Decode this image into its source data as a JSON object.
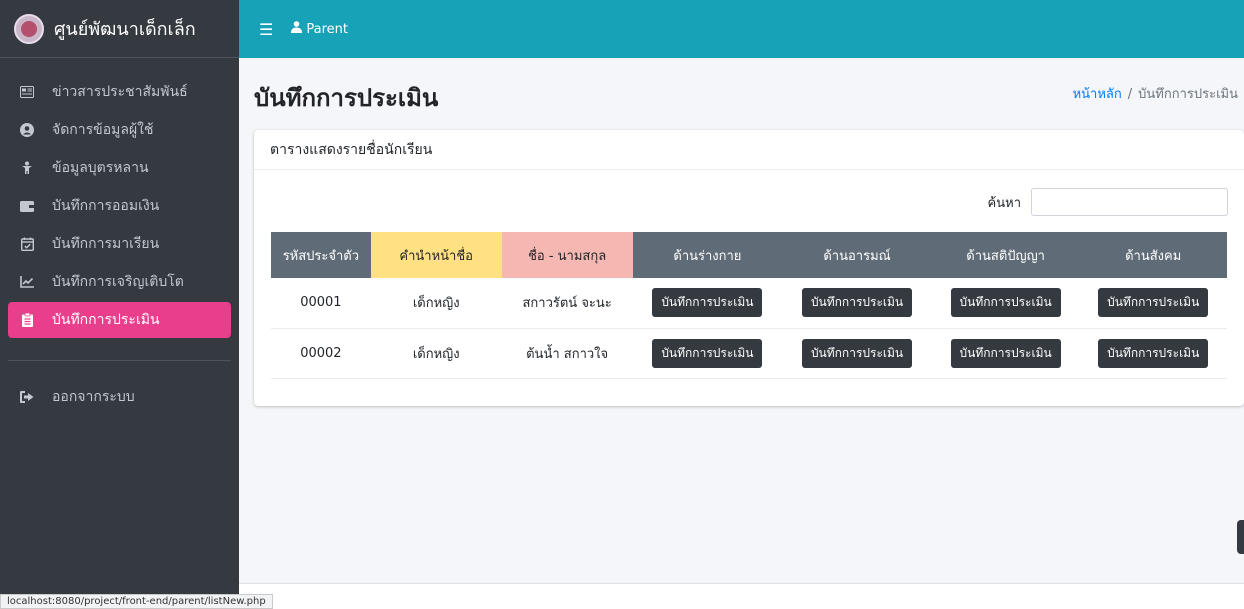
{
  "brand": {
    "title": "ศูนย์พัฒนาเด็กเล็ก"
  },
  "sidebar": {
    "items": [
      {
        "label": "ข่าวสารประชาสัมพันธ์",
        "icon": "newspaper-icon"
      },
      {
        "label": "จัดการข้อมูลผู้ใช้",
        "icon": "user-circle-icon"
      },
      {
        "label": "ข้อมูลบุตรหลาน",
        "icon": "child-icon"
      },
      {
        "label": "บันทึกการออมเงิน",
        "icon": "wallet-icon"
      },
      {
        "label": "บันทึกการมาเรียน",
        "icon": "calendar-check-icon"
      },
      {
        "label": "บันทึกการเจริญเติบโต",
        "icon": "chart-line-icon"
      },
      {
        "label": "บันทึกการประเมิน",
        "icon": "clipboard-icon",
        "active": true
      }
    ],
    "logout": {
      "label": "ออกจากระบบ",
      "icon": "sign-out-icon"
    }
  },
  "topbar": {
    "user_label": "Parent"
  },
  "page": {
    "title": "บันทึกการประเมิน"
  },
  "breadcrumb": {
    "home": "หน้าหลัก",
    "separator": "/",
    "current": "บันทึกการประเมิน"
  },
  "card": {
    "title": "ตารางแสดงรายชื่อนักเรียน",
    "search_label": "ค้นหา",
    "search_value": ""
  },
  "table": {
    "headers": [
      "รหัสประจำตัว",
      "คำนำหน้าชื่อ",
      "ชื่อ - นามสกุล",
      "ด้านร่างกาย",
      "ด้านอารมณ์",
      "ด้านสติปัญญา",
      "ด้านสังคม"
    ],
    "rows": [
      {
        "id": "00001",
        "prefix": "เด็กหญิง",
        "name": "สกาวรัตน์ จะนะ"
      },
      {
        "id": "00002",
        "prefix": "เด็กหญิง",
        "name": "ต้นน้ำ สกาวใจ"
      }
    ],
    "button_label": "บันทึกการประเมิน"
  },
  "status_bar": {
    "url": "localhost:8080/project/front-end/parent/listNew.php"
  },
  "colors": {
    "sidebar": "#343a40",
    "topbar": "#17a2b8",
    "active": "#e83e8c",
    "header_dark": "#5f6b77",
    "header_yellow": "#ffe082",
    "header_pink": "#f5b7b1"
  }
}
